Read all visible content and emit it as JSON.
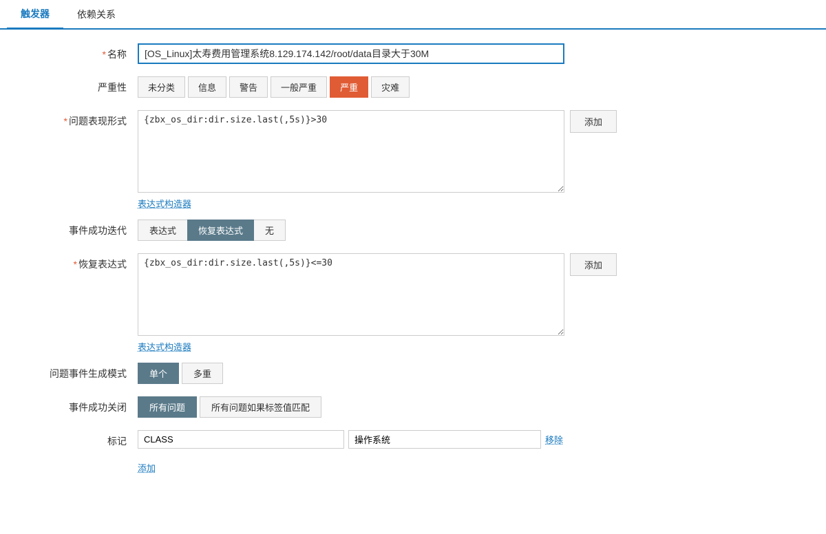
{
  "tabs": [
    {
      "id": "trigger",
      "label": "触发器",
      "active": true
    },
    {
      "id": "dependency",
      "label": "依赖关系",
      "active": false
    }
  ],
  "form": {
    "name_label": "名称",
    "name_required": "*",
    "name_value": "[OS_Linux]太寿费用管理系统8.129.174.142/root/data目录大于30M",
    "severity_label": "严重性",
    "severity_buttons": [
      {
        "id": "unclassified",
        "label": "未分类",
        "active": false
      },
      {
        "id": "info",
        "label": "信息",
        "active": false
      },
      {
        "id": "warning",
        "label": "警告",
        "active": false
      },
      {
        "id": "average",
        "label": "一般严重",
        "active": false
      },
      {
        "id": "high",
        "label": "严重",
        "active": true
      },
      {
        "id": "disaster",
        "label": "灾难",
        "active": false
      }
    ],
    "problem_expr_label": "问题表现形式",
    "problem_expr_required": "*",
    "problem_expr_value": "{zbx_os_dir:dir.size.last(,5s)}>30",
    "problem_expr_add": "添加",
    "expr_builder_link": "表达式构造器",
    "event_success_label": "事件成功迭代",
    "event_success_buttons": [
      {
        "id": "expression",
        "label": "表达式",
        "active": false
      },
      {
        "id": "recovery",
        "label": "恢复表达式",
        "active": true
      },
      {
        "id": "none",
        "label": "无",
        "active": false
      }
    ],
    "recovery_expr_label": "恢复表达式",
    "recovery_expr_required": "*",
    "recovery_expr_value": "{zbx_os_dir:dir.size.last(,5s)}<=30",
    "recovery_expr_add": "添加",
    "recovery_expr_builder_link": "表达式构造器",
    "problem_mode_label": "问题事件生成模式",
    "problem_mode_buttons": [
      {
        "id": "single",
        "label": "单个",
        "active": true
      },
      {
        "id": "multiple",
        "label": "多重",
        "active": false
      }
    ],
    "event_close_label": "事件成功关闭",
    "event_close_buttons": [
      {
        "id": "all",
        "label": "所有问题",
        "active": true
      },
      {
        "id": "tag_match",
        "label": "所有问题如果标签值匹配",
        "active": false
      }
    ],
    "tag_label": "标记",
    "tag_name_value": "CLASS",
    "tag_value_value": "操作系统",
    "tag_remove_label": "移除",
    "add_tag_link": "添加"
  }
}
